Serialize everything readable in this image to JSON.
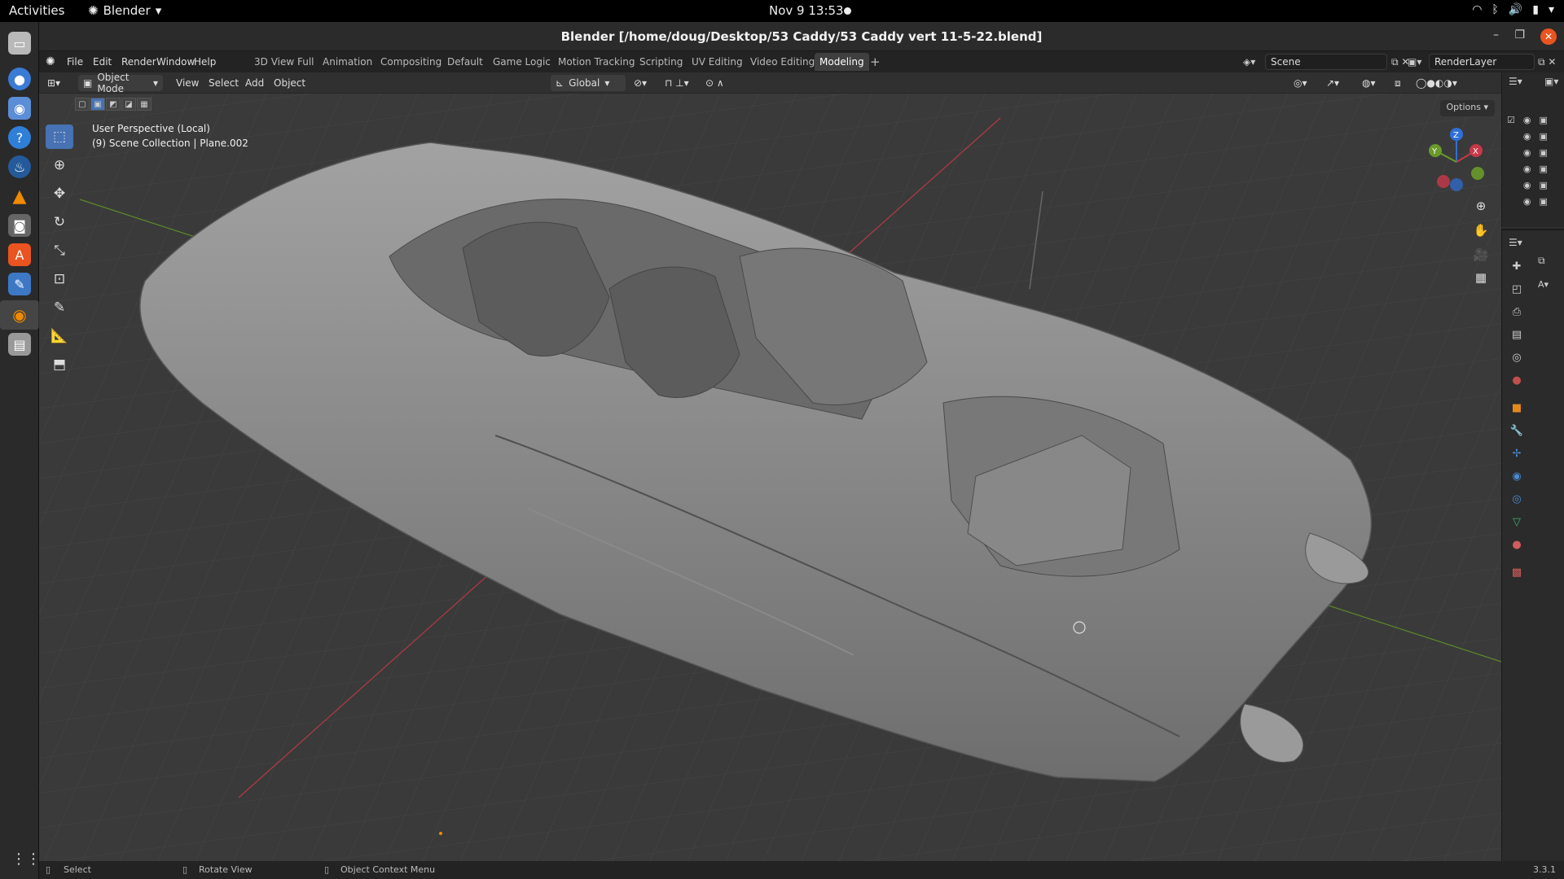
{
  "topbar": {
    "activities": "Activities",
    "app_name": "Blender",
    "clock": "Nov 9  13:53"
  },
  "dock": {
    "items": [
      "files-icon",
      "chrome-icon",
      "screenshot-icon",
      "help-icon",
      "steam-icon",
      "vlc-icon",
      "gamepad-icon",
      "appstore-icon",
      "text-editor-icon",
      "blender-icon",
      "drive-icon"
    ]
  },
  "window": {
    "title": "Blender [/home/doug/Desktop/53 Caddy/53 Caddy vert 11-5-22.blend]"
  },
  "menubar": {
    "menus": [
      "File",
      "Edit",
      "Render",
      "Window",
      "Help"
    ],
    "workspaces": [
      "3D View Full",
      "Animation",
      "Compositing",
      "Default",
      "Game Logic",
      "Motion Tracking",
      "Scripting",
      "UV Editing",
      "Video Editing",
      "Modeling"
    ],
    "active_workspace": "Modeling",
    "scene": "Scene",
    "view_layer": "RenderLayer"
  },
  "viewport_header": {
    "mode": "Object Mode",
    "menus": [
      "View",
      "Select",
      "Add",
      "Object"
    ],
    "transform_orientation": "Global",
    "options_label": "Options"
  },
  "viewport": {
    "perspective": "User Perspective (Local)",
    "collection": "(9) Scene Collection | Plane.002",
    "gizmo_axes": [
      "X",
      "Y",
      "Z"
    ]
  },
  "statusbar": {
    "select": "Select",
    "rotate": "Rotate View",
    "context": "Object Context Menu",
    "version": "3.3.1"
  },
  "colors": {
    "accent": "#4772b3",
    "ubuntu_close": "#e95420",
    "x_axis": "#c8384a",
    "y_axis": "#6a9a2a",
    "z_axis": "#2f6fd9"
  }
}
